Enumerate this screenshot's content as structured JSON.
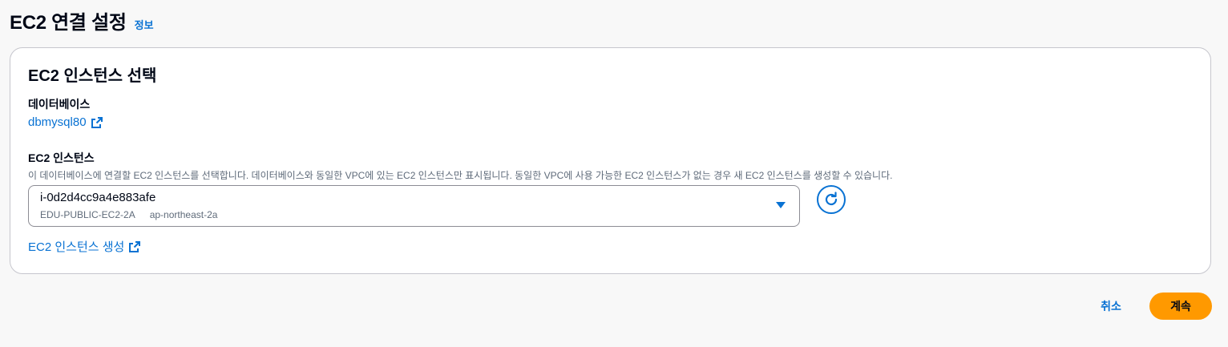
{
  "header": {
    "title": "EC2 연결 설정",
    "info_link": "정보"
  },
  "card": {
    "title": "EC2 인스턴스 선택",
    "database": {
      "label": "데이터베이스",
      "value": "dbmysql80"
    },
    "ec2": {
      "label": "EC2 인스턴스",
      "description": "이 데이터베이스에 연결할 EC2 인스턴스를 선택합니다. 데이터베이스와 동일한 VPC에 있는 EC2 인스턴스만 표시됩니다. 동일한 VPC에 사용 가능한 EC2 인스턴스가 없는 경우 새 EC2 인스턴스를 생성할 수 있습니다.",
      "selected": {
        "instance_id": "i-0d2d4cc9a4e883afe",
        "tags": [
          "EDU-PUBLIC-EC2-2A",
          "ap-northeast-2a"
        ]
      }
    },
    "create_link": "EC2 인스턴스 생성"
  },
  "footer": {
    "cancel": "취소",
    "continue": "계속"
  },
  "colors": {
    "link": "#0972d3",
    "primary": "#ff9900",
    "border": "#8c8c94"
  },
  "icons": {
    "external": "external-link-icon",
    "refresh": "refresh-icon",
    "caret": "caret-down-icon"
  }
}
